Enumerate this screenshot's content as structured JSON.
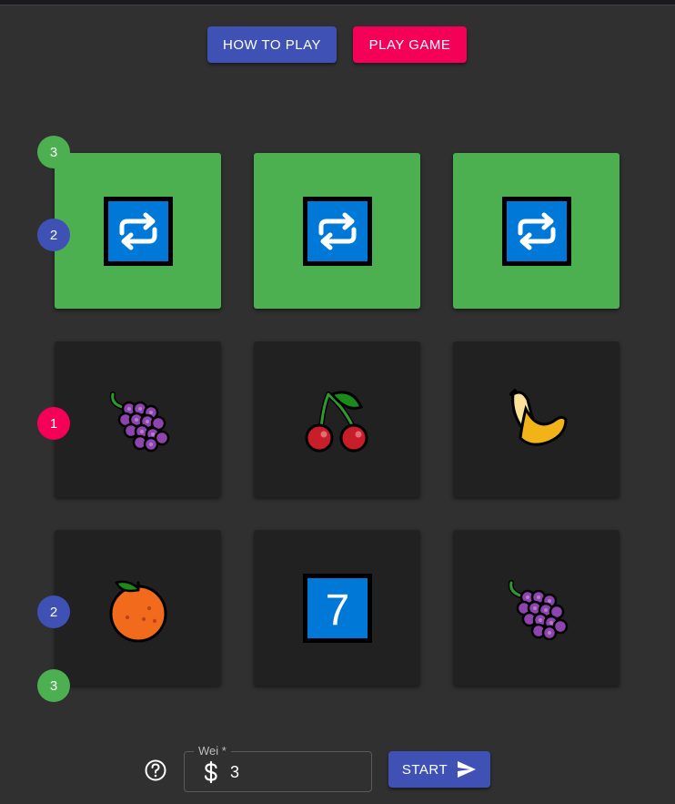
{
  "header": {
    "how_to_play_label": "HOW TO PLAY",
    "play_game_label": "PLAY GAME"
  },
  "grid": {
    "rows": [
      [
        {
          "symbol": "repeat-icon",
          "winning": true
        },
        {
          "symbol": "repeat-icon",
          "winning": true
        },
        {
          "symbol": "repeat-icon",
          "winning": true
        }
      ],
      [
        {
          "symbol": "grapes-icon",
          "winning": false
        },
        {
          "symbol": "cherries-icon",
          "winning": false
        },
        {
          "symbol": "banana-icon",
          "winning": false
        }
      ],
      [
        {
          "symbol": "orange-icon",
          "winning": false
        },
        {
          "symbol": "seven-icon",
          "winning": false,
          "text": "7"
        },
        {
          "symbol": "grapes-icon",
          "winning": false
        }
      ]
    ]
  },
  "paylines": {
    "top_3": "3",
    "row1_2": "2",
    "row2_1": "1",
    "row3_2": "2",
    "bottom_3": "3"
  },
  "bet": {
    "label": "Wei *",
    "value": "3",
    "currency_icon": "dollar-icon",
    "help_icon": "help-circle-icon"
  },
  "start": {
    "label": "START",
    "icon": "send-icon"
  },
  "colors": {
    "background": "#303030",
    "tile": "#212121",
    "win_tile": "#4caf50",
    "primary": "#3f51b5",
    "secondary": "#f50057",
    "emoji_blue": "#0078d7"
  }
}
